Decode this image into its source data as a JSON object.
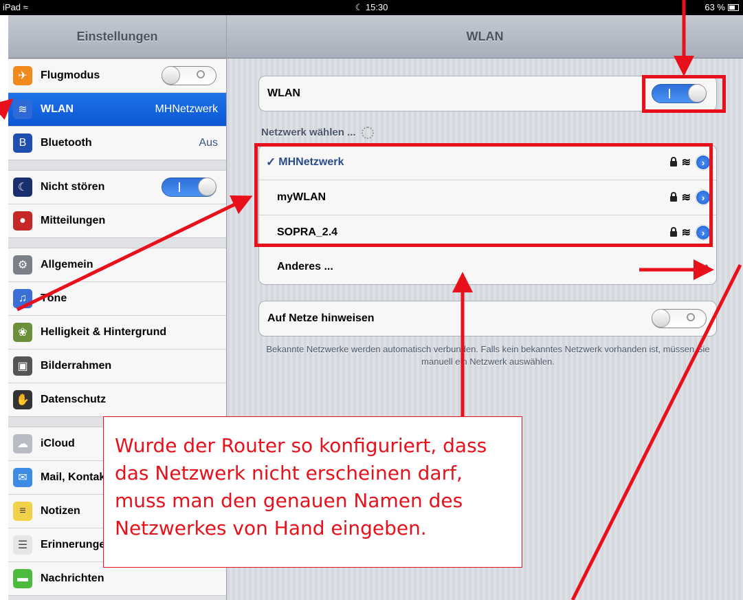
{
  "status_bar": {
    "device": "iPad",
    "time": "15:30",
    "battery": "63 %",
    "battery_level": 0.63
  },
  "sidebar": {
    "title": "Einstellungen",
    "groups": [
      [
        {
          "label": "Flugmodus",
          "switch": "off",
          "icon": "airplane-icon",
          "color": "#f08a1d"
        },
        {
          "label": "WLAN",
          "value": "MHNetzwerk",
          "active": true,
          "icon": "wifi-icon",
          "color": "#2d6ad8"
        },
        {
          "label": "Bluetooth",
          "value": "Aus",
          "icon": "bluetooth-icon",
          "color": "#1e4fb0"
        }
      ],
      [
        {
          "label": "Nicht stören",
          "switch": "on",
          "icon": "moon-icon",
          "color": "#1b2f6e"
        },
        {
          "label": "Mitteilungen",
          "icon": "notifications-icon",
          "color": "#c62828"
        }
      ],
      [
        {
          "label": "Allgemein",
          "icon": "gear-icon",
          "color": "#7a7f88"
        },
        {
          "label": "Töne",
          "icon": "speaker-icon",
          "color": "#3b6fd6"
        },
        {
          "label": "Helligkeit & Hintergrund",
          "icon": "flower-icon",
          "color": "#6c8f3c"
        },
        {
          "label": "Bilderrahmen",
          "icon": "picture-frame-icon",
          "color": "#555555"
        },
        {
          "label": "Datenschutz",
          "icon": "hand-icon",
          "color": "#333333"
        }
      ],
      [
        {
          "label": "iCloud",
          "icon": "cloud-icon",
          "color": "#b8bcc4"
        },
        {
          "label": "Mail, Kontakte, Kalender",
          "icon": "mail-icon",
          "color": "#3c8ce6"
        },
        {
          "label": "Notizen",
          "icon": "notes-icon",
          "color": "#f2d14a"
        },
        {
          "label": "Erinnerungen",
          "icon": "reminders-icon",
          "color": "#e6e6e6"
        },
        {
          "label": "Nachrichten",
          "icon": "messages-icon",
          "color": "#4cba3c"
        }
      ]
    ]
  },
  "main": {
    "title": "WLAN",
    "wlan_label": "WLAN",
    "wlan_switch": "on",
    "section_title": "Netzwerk wählen ...",
    "networks": [
      {
        "name": "MHNetzwerk",
        "selected": true,
        "locked": true
      },
      {
        "name": "myWLAN",
        "selected": false,
        "locked": true
      },
      {
        "name": "SOPRA_2.4",
        "selected": false,
        "locked": true
      }
    ],
    "other_label": "Anderes ...",
    "ask_label": "Auf Netze hinweisen",
    "ask_switch": "off",
    "footer": "Bekannte Netzwerke werden automatisch verbunden. Falls kein bekanntes Netzwerk vorhanden ist, müssen Sie manuell ein Netzwerk auswählen."
  },
  "annotation": {
    "text": "Wurde der Router so konfiguriert, dass das Netzwerk nicht erscheinen darf, muss man den genauen Namen des Netzwerkes von Hand eingeben.",
    "color": "#e8101a"
  }
}
